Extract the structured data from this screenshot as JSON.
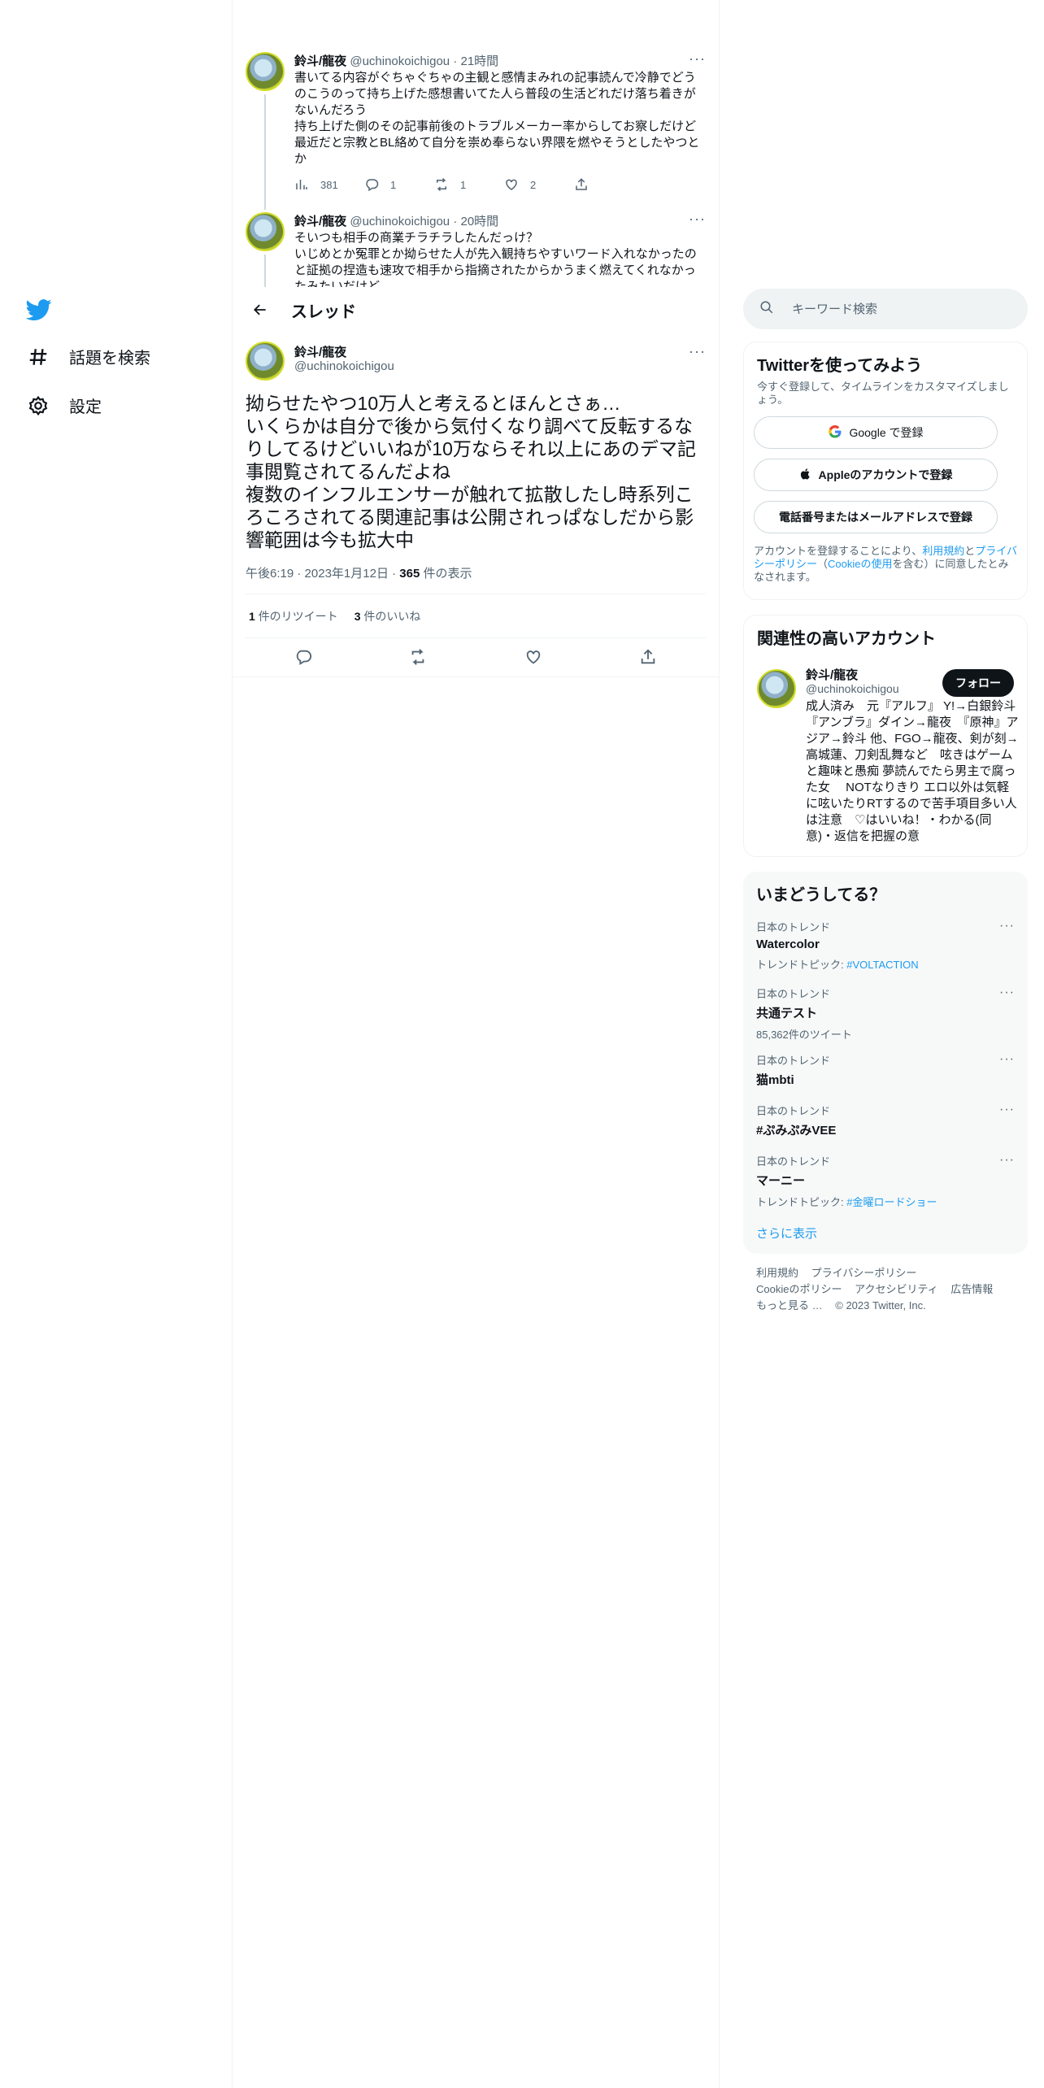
{
  "nav": {
    "explore": "話題を検索",
    "settings": "設定"
  },
  "thread_header": {
    "title": "スレッド"
  },
  "parent_tweets": [
    {
      "name": "鈴斗/龍夜",
      "handle": "@uchinokoichigou",
      "time": "21時間",
      "text": "書いてる内容がぐちゃぐちゃの主観と感情まみれの記事読んで冷静でどうのこうのって持ち上げた感想書いてた人ら普段の生活どれだけ落ち着きがないんだろう\n持ち上げた側のその記事前後のトラブルメーカー率からしてお察しだけど最近だと宗教とBL絡めて自分を崇め奉らない界隈を燃やそうとしたやつとか",
      "views": "381",
      "replies": "1",
      "retweets": "1",
      "likes": "2"
    },
    {
      "name": "鈴斗/龍夜",
      "handle": "@uchinokoichigou",
      "time": "20時間",
      "text": "そいつも相手の商業チラチラしたんだっけ？\nいじめとか冤罪とか拗らせた人が先入観持ちやすいワード入れなかったのと証拠の捏造も速攻で相手から指摘されたからかうまく燃えてくれなかったみたいだけど"
    }
  ],
  "focus_tweet": {
    "name": "鈴斗/龍夜",
    "handle": "@uchinokoichigou",
    "text": "拗らせたやつ10万人と考えるとほんとさぁ…\nいくらかは自分で後から気付くなり調べて反転するなりしてるけどいいねが10万ならそれ以上にあのデマ記事閲覧されてるんだよね\n複数のインフルエンサーが触れて拡散したし時系列ころころされてる関連記事は公開されっぱなしだから影響範囲は今も拡大中",
    "time": "午後6:19",
    "date": "2023年1月12日",
    "views_count": "365",
    "views_label": "件の表示",
    "retweet_count": "1",
    "retweet_label": "件のリツイート",
    "like_count": "3",
    "like_label": "件のいいね"
  },
  "search": {
    "placeholder": "キーワード検索"
  },
  "signup": {
    "title": "Twitterを使ってみよう",
    "subtitle": "今すぐ登録して、タイムラインをカスタマイズしましょう。",
    "google": "Google で登録",
    "apple": "Appleのアカウントで登録",
    "phone": "電話番号またはメールアドレスで登録",
    "legal_1": "アカウントを登録することにより、",
    "legal_terms": "利用規約",
    "legal_and": "と",
    "legal_privacy": "プライバシーポリシー",
    "legal_paren_open": "（",
    "legal_cookie": "Cookieの使用",
    "legal_2": "を含む）に同意したとみなされます。"
  },
  "relevant": {
    "title": "関連性の高いアカウント",
    "name": "鈴斗/龍夜",
    "handle": "@uchinokoichigou",
    "follow": "フォロー",
    "bio": "成人済み　元『アルフ』 Y!→白銀鈴斗 『アンブラ』ダイン→龍夜　『原神』アジア→鈴斗 他、FGO→龍夜、剣が刻→高城蓮、刀剣乱舞など　呟きはゲームと趣味と愚痴 夢読んでたら男主で腐った女　 NOTなりきり エロ以外は気軽に呟いたりRTするので苦手項目多い人は注意　♡はいいね！・わかる(同意)・返信を把握の意"
  },
  "trends": {
    "title": "いまどうしてる？",
    "items": [
      {
        "context": "日本のトレンド",
        "name": "Watercolor",
        "extra_label": "トレンドトピック: ",
        "extra_tag": "#VOLTACTION"
      },
      {
        "context": "日本のトレンド",
        "name": "共通テスト",
        "extra_label": "85,362件のツイート",
        "extra_tag": ""
      },
      {
        "context": "日本のトレンド",
        "name": "猫mbti",
        "extra_label": "",
        "extra_tag": ""
      },
      {
        "context": "日本のトレンド",
        "name": "#ぷみぷみVEE",
        "extra_label": "",
        "extra_tag": ""
      },
      {
        "context": "日本のトレンド",
        "name": "マーニー",
        "extra_label": "トレンドトピック: ",
        "extra_tag": "#金曜ロードショー"
      }
    ],
    "show_more": "さらに表示"
  },
  "footer": {
    "terms": "利用規約",
    "privacy": "プライバシーポリシー",
    "cookie": "Cookieのポリシー",
    "accessibility": "アクセシビリティ",
    "ads": "広告情報",
    "more": "もっと見る …",
    "copyright": "© 2023 Twitter, Inc."
  },
  "colors": {
    "accent": "#1d9bf0",
    "text": "#0f1419",
    "muted": "#536471"
  }
}
